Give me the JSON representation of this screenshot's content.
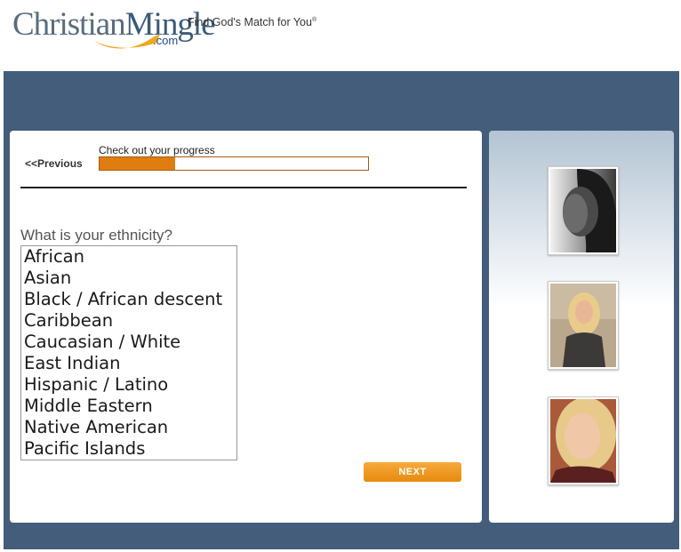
{
  "header": {
    "logo_text_christian": "Christian",
    "logo_text_mingle": "Mingle",
    "logo_text_com": ".com",
    "tagline": "Find God's Match for You",
    "tagline_mark": "®"
  },
  "progress": {
    "previous_label": "<<Previous",
    "label": "Check out your progress",
    "fraction": 0.28
  },
  "question": {
    "label": "What is your ethnicity?",
    "options": [
      "African",
      "Asian",
      "Black / African descent",
      "Caribbean",
      "Caucasian / White",
      "East Indian",
      "Hispanic / Latino",
      "Middle Eastern",
      "Native American",
      "Pacific Islands"
    ]
  },
  "buttons": {
    "next_label": "NEXT"
  },
  "colors": {
    "accent_orange": "#e07d10",
    "band_blue": "#435d7a",
    "logo_blue": "#1f4f86"
  }
}
